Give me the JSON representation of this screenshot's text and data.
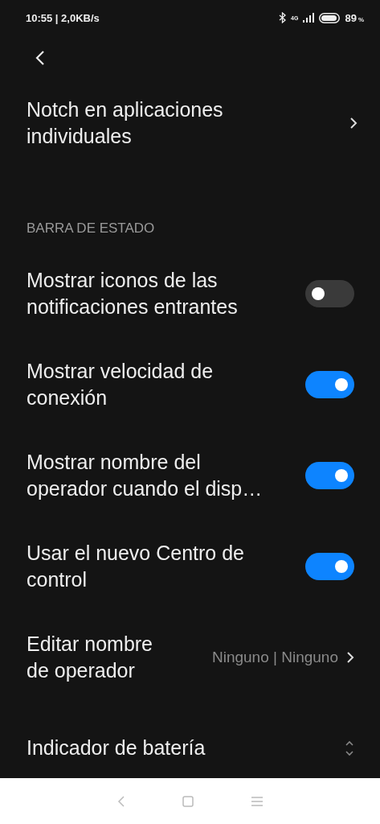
{
  "status_bar": {
    "time": "10:55 | 2,0KB/s",
    "network": "4G",
    "battery": "89",
    "battery_unit": "%"
  },
  "top_item": {
    "title": "Notch en aplicaciones individuales"
  },
  "section": {
    "header": "BARRA DE ESTADO",
    "items": [
      {
        "kind": "toggle",
        "title": "Mostrar iconos de las notificaciones entrantes",
        "on": false
      },
      {
        "kind": "toggle",
        "title": "Mostrar velocidad de conexión",
        "on": true
      },
      {
        "kind": "toggle",
        "title": "Mostrar nombre del operador cuando el disp…",
        "on": true
      },
      {
        "kind": "toggle",
        "title": "Usar el nuevo Centro de control",
        "on": true
      },
      {
        "kind": "value",
        "title": "Editar nombre de operador",
        "value": "Ninguno | Ninguno"
      },
      {
        "kind": "select",
        "title": "Indicador de batería"
      }
    ]
  }
}
